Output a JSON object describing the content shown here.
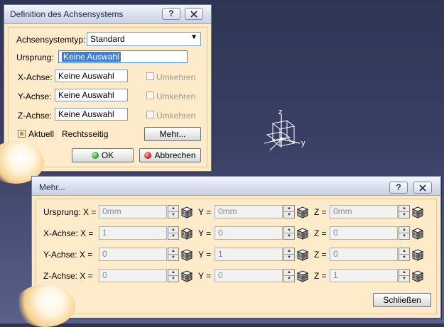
{
  "dialog1": {
    "title": "Definition des Achsensystems",
    "help_button": "?",
    "axis_type_label": "Achsensystemtyp:",
    "axis_type_value": "Standard",
    "origin_label": "Ursprung:",
    "origin_value": "Keine Auswahl",
    "axes": [
      {
        "label": "X-Achse:",
        "value": "Keine Auswahl",
        "reverse": "Umkehren"
      },
      {
        "label": "Y-Achse:",
        "value": "Keine Auswahl",
        "reverse": "Umkehren"
      },
      {
        "label": "Z-Achse:",
        "value": "Keine Auswahl",
        "reverse": "Umkehren"
      }
    ],
    "current_label": "Aktuell",
    "right_handed_label": "Rechtsseitig",
    "more_button": "Mehr...",
    "ok_button": "OK",
    "cancel_button": "Abbrechen"
  },
  "compass": {
    "z": "z",
    "y": "y"
  },
  "dialog2": {
    "title": "Mehr...",
    "help_button": "?",
    "rows": [
      {
        "label": "Ursprung: X =",
        "x": "0mm",
        "y": "0mm",
        "z": "0mm"
      },
      {
        "label": "X-Achse: X =",
        "x": "1",
        "y": "0",
        "z": "0"
      },
      {
        "label": "Y-Achse: X =",
        "x": "0",
        "y": "1",
        "z": "0"
      },
      {
        "label": "Z-Achse: X =",
        "x": "0",
        "y": "0",
        "z": "1"
      }
    ],
    "y_label": "Y =",
    "z_label": "Z =",
    "close_button": "Schließen"
  }
}
